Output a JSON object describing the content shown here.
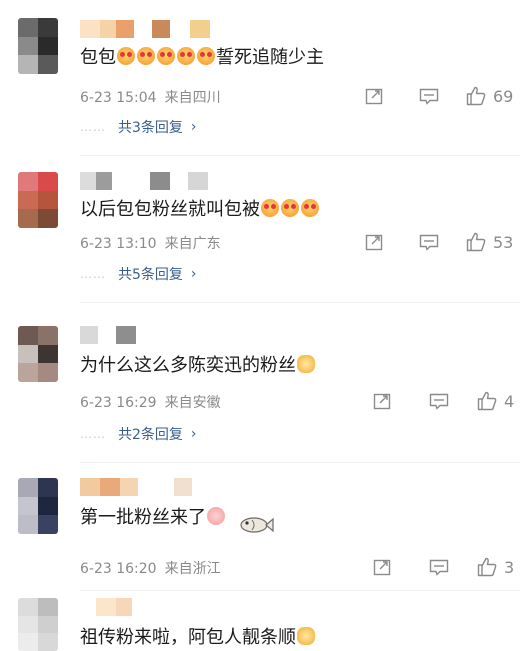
{
  "comments": [
    {
      "text": "包包",
      "text_suffix": "誓死追随少主",
      "emoji_count": 5,
      "date": "6-23 15:04",
      "location": "来自四川",
      "likes": "69",
      "replies": "共3条回复"
    },
    {
      "text": "以后包包粉丝就叫包被",
      "text_suffix": "",
      "emoji_count": 3,
      "date": "6-23 13:10",
      "location": "来自广东",
      "likes": "53",
      "replies": "共5条回复"
    },
    {
      "text": "为什么这么多陈奕迅的粉丝",
      "text_suffix": "",
      "emoji_count": 1,
      "date": "6-23 16:29",
      "location": "来自安徽",
      "likes": "4",
      "replies": "共2条回复"
    },
    {
      "text": "第一批粉丝来了",
      "text_suffix": "",
      "emoji_count": 1,
      "date": "6-23 16:20",
      "location": "来自浙江",
      "likes": "3",
      "replies": ""
    },
    {
      "text": "祖传粉来啦，阿包人靓条顺",
      "text_suffix": "",
      "emoji_count": 1,
      "date": "",
      "location": "",
      "likes": "",
      "replies": ""
    }
  ],
  "ui": {
    "reply_dots": "……",
    "chevron": "›"
  },
  "icons": [
    "share-icon",
    "comment-icon",
    "like-icon",
    "fish-sticker-icon"
  ],
  "colors": {
    "meta_gray": "#8a8a8a",
    "reply_blue": "#3a5e8c"
  }
}
